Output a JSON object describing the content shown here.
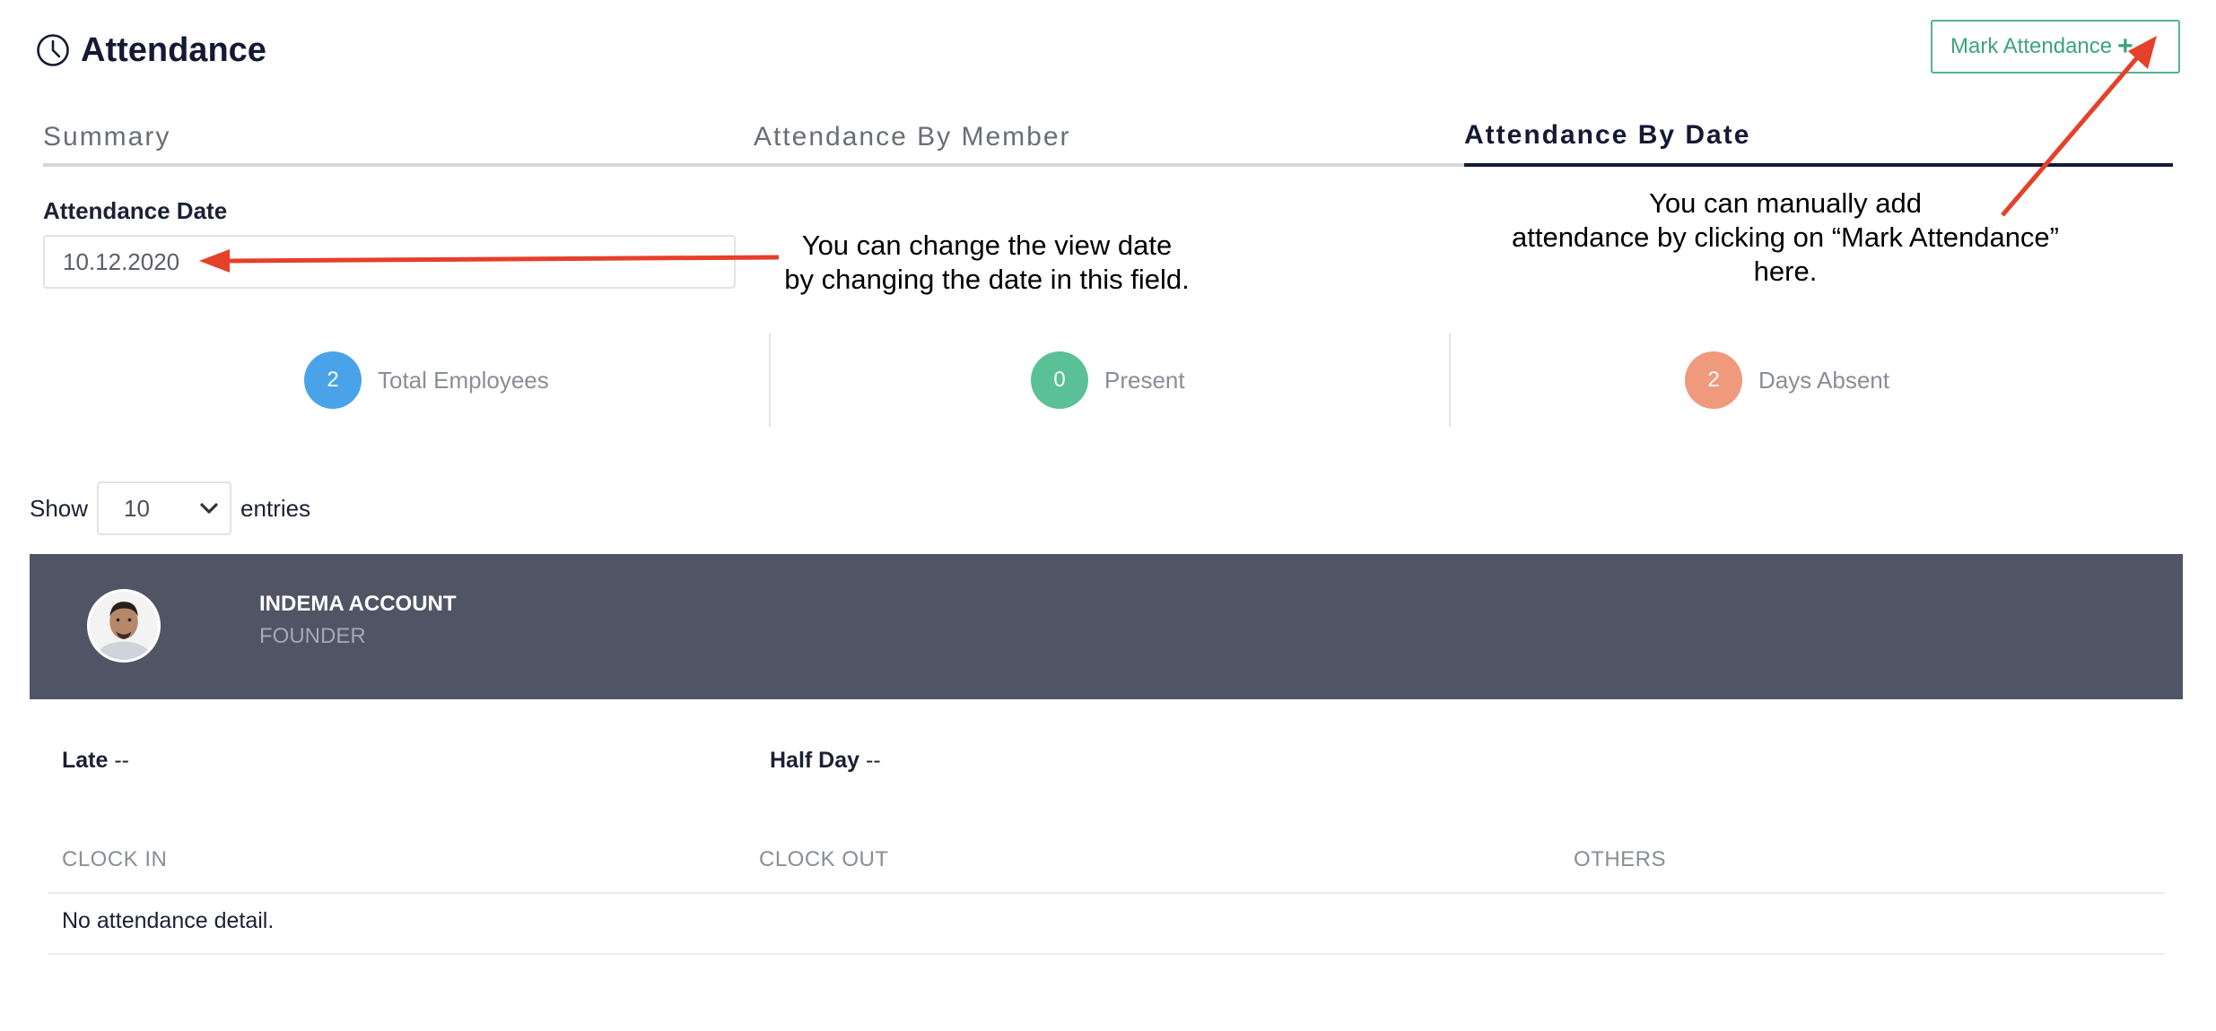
{
  "header": {
    "title": "Attendance",
    "mark_button": {
      "label": "Mark Attendance",
      "icon": "+"
    }
  },
  "tabs": [
    {
      "label": "Summary",
      "active": false
    },
    {
      "label": "Attendance By Member",
      "active": false
    },
    {
      "label": "Attendance By Date",
      "active": true
    }
  ],
  "date_filter": {
    "label": "Attendance Date",
    "value": "10.12.2020"
  },
  "annotations": {
    "date_help_line1": "You can change the view date",
    "date_help_line2": "by changing the date in this field.",
    "mark_help_line1": "You can manually add",
    "mark_help_line2": "attendance by clicking on “Mark Attendance”",
    "mark_help_line3": "here.",
    "arrow_color": "#e5402a"
  },
  "stats": [
    {
      "value": "2",
      "label": "Total Employees",
      "color": "#4aa3e8"
    },
    {
      "value": "0",
      "label": "Present",
      "color": "#5ac095"
    },
    {
      "value": "2",
      "label": "Days Absent",
      "color": "#ef9a7c"
    }
  ],
  "entries": {
    "show_label": "Show",
    "selected": "10",
    "suffix": "entries"
  },
  "member": {
    "name": "INDEMA ACCOUNT",
    "role": "FOUNDER",
    "bar_color": "#4f5565"
  },
  "summary_fields": {
    "late_label": "Late",
    "late_value": "--",
    "half_day_label": "Half Day",
    "half_day_value": "--"
  },
  "detail_table": {
    "headers": [
      "CLOCK IN",
      "CLOCK OUT",
      "OTHERS"
    ],
    "empty_message": "No attendance detail."
  }
}
